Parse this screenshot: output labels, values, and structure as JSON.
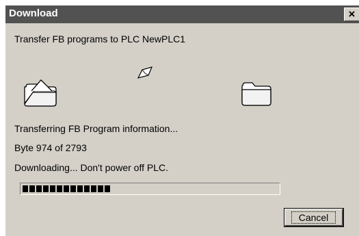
{
  "window": {
    "title": "Download",
    "close_label": "×"
  },
  "header": {
    "description": "Transfer FB programs to PLC NewPLC1"
  },
  "status": {
    "step": "Transferring FB Program information...",
    "bytes": "Byte 974 of 2793",
    "warning": "Downloading... Don't power off PLC."
  },
  "progress": {
    "current": 974,
    "total": 2793,
    "blocks_filled": 13
  },
  "icons": {
    "source": "folder-open-icon",
    "target": "folder-icon",
    "flying": "paper-icon"
  },
  "buttons": {
    "cancel_label": "Cancel"
  },
  "colors": {
    "titlebar": "#525252",
    "dialog": "#d4d0c8",
    "progress_block": "#000000"
  }
}
